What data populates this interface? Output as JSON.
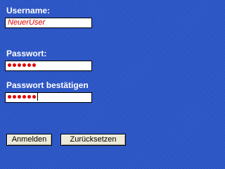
{
  "form": {
    "username_label": "Username:",
    "username_value": "NeuerUser",
    "password_label": "Passwort:",
    "password_mask_count": 6,
    "confirm_label": "Passwort bestätigen",
    "confirm_mask_count": 6
  },
  "buttons": {
    "login_label": "Anmelden",
    "reset_label": "Zurücksetzen"
  },
  "colors": {
    "background": "#2b56c8",
    "input_text": "#e00000"
  }
}
